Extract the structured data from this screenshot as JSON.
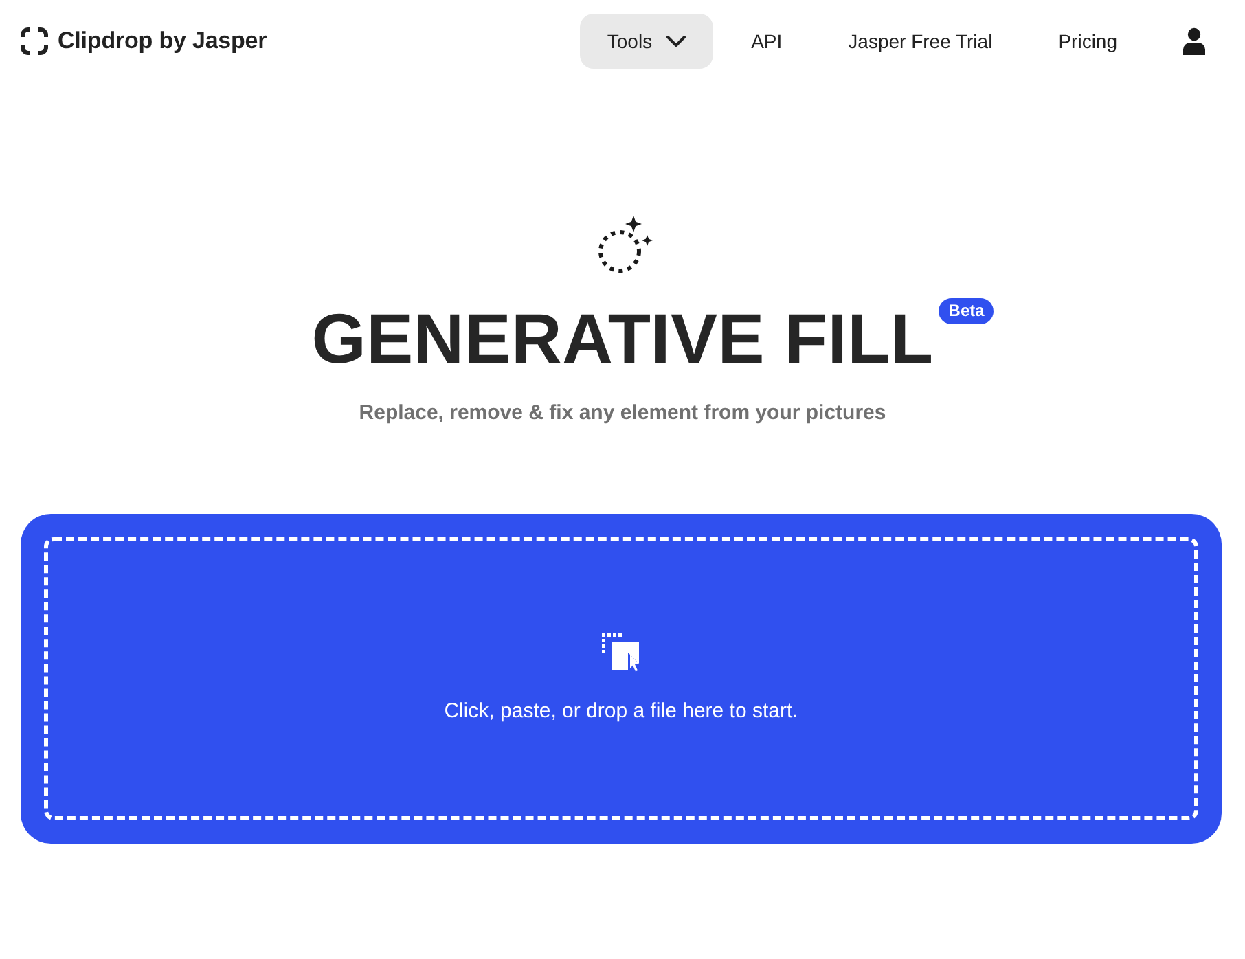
{
  "header": {
    "logo": {
      "text": "Clipdrop by Jasper"
    },
    "nav": [
      {
        "label": "Tools",
        "kind": "dropdown",
        "selected": true
      },
      {
        "label": "API",
        "kind": "link",
        "selected": false
      },
      {
        "label": "Jasper Free Trial",
        "kind": "link",
        "selected": false
      },
      {
        "label": "Pricing",
        "kind": "link",
        "selected": false
      }
    ]
  },
  "hero": {
    "title": "GENERATIVE FILL",
    "badge": "Beta",
    "subtitle": "Replace, remove & fix any element from your pictures"
  },
  "upload": {
    "prompt": "Click, paste, or drop a file here to start."
  }
}
